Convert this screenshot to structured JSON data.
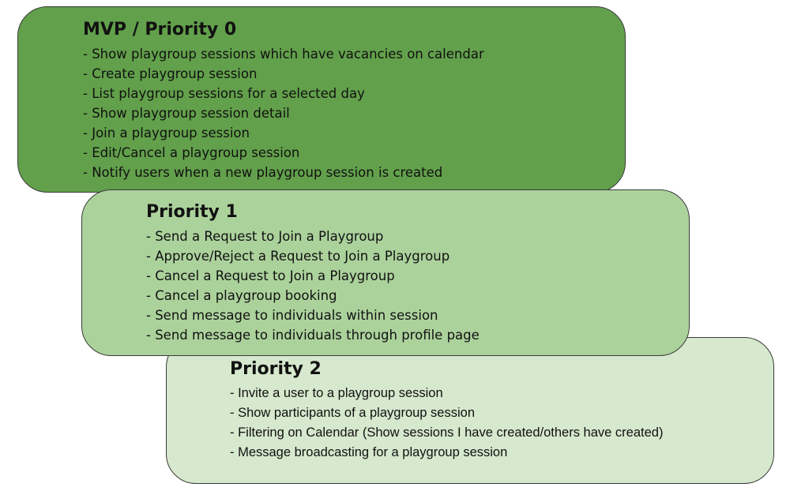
{
  "colors": {
    "priority_0": "#62a04b",
    "priority_1": "#acd29c",
    "priority_2": "#d6e8cd"
  },
  "boxes": [
    {
      "title": "MVP / Priority 0",
      "items": [
        "- Show playgroup sessions which have vacancies on calendar",
        "- Create playgroup session",
        "- List playgroup sessions for a selected day",
        "- Show playgroup session detail",
        "- Join a playgroup session",
        "- Edit/Cancel a playgroup session",
        "- Notify users when a new playgroup session is created"
      ]
    },
    {
      "title": "Priority 1",
      "items": [
        "- Send a Request to Join a Playgroup",
        "- Approve/Reject a Request to Join a Playgroup",
        "- Cancel a Request to Join a Playgroup",
        "- Cancel a playgroup booking",
        "- Send message to individuals within session",
        "- Send message to individuals through profile page"
      ]
    },
    {
      "title": "Priority 2",
      "items": [
        "- Invite a user to a playgroup session",
        "- Show participants of a playgroup session",
        "- Filtering on Calendar (Show sessions I have created/others have created)",
        "- Message broadcasting for a playgroup session"
      ]
    }
  ]
}
